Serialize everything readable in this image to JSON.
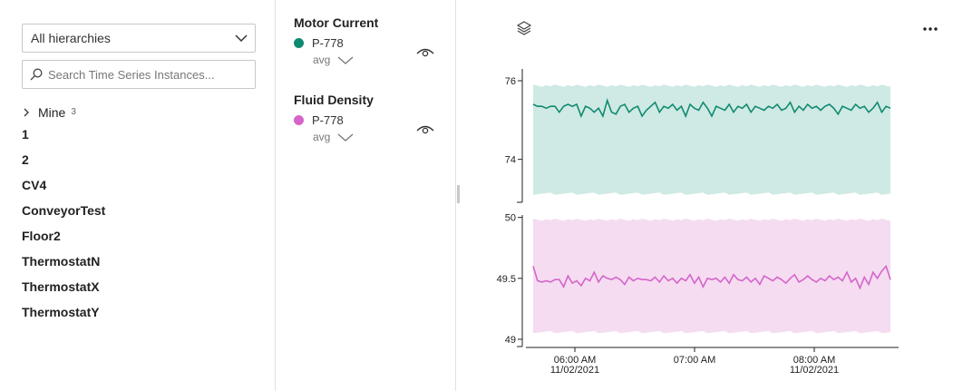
{
  "hierarchy": {
    "dropdown_value": "All hierarchies",
    "search_placeholder": "Search Time Series Instances...",
    "tree": {
      "parent_label": "Mine",
      "parent_count": "3",
      "items": [
        "1",
        "2",
        "CV4",
        "ConveyorTest",
        "Floor2",
        "ThermostatN",
        "ThermostatX",
        "ThermostatY"
      ]
    }
  },
  "legend": {
    "groups": [
      {
        "title": "Motor Current",
        "instance": "P-778",
        "aggregate": "avg",
        "color": "#0f8a72"
      },
      {
        "title": "Fluid Density",
        "instance": "P-778",
        "aggregate": "avg",
        "color": "#d565c9"
      }
    ]
  },
  "chart_data": {
    "type": "line",
    "x_ticks": [
      {
        "time": "06:00 AM",
        "date": "11/02/2021"
      },
      {
        "time": "07:00 AM",
        "date": ""
      },
      {
        "time": "08:00 AM",
        "date": "11/02/2021"
      }
    ],
    "x_range": [
      "05:35 AM",
      "08:40 AM"
    ],
    "series": [
      {
        "name": "Motor Current",
        "color": "#0f8a72",
        "band_color": "#cfe9e4",
        "ylim": [
          73.0,
          76.3
        ],
        "y_ticks": [
          "76",
          "74"
        ],
        "y_tick_values": [
          76,
          74
        ],
        "band": [
          73.1,
          75.9
        ],
        "values": [
          75.4,
          75.35,
          75.35,
          75.3,
          75.35,
          75.35,
          75.2,
          75.35,
          75.4,
          75.35,
          75.4,
          75.1,
          75.35,
          75.3,
          75.2,
          75.3,
          75.1,
          75.5,
          75.2,
          75.15,
          75.35,
          75.4,
          75.2,
          75.3,
          75.35,
          75.1,
          75.25,
          75.35,
          75.45,
          75.2,
          75.35,
          75.3,
          75.4,
          75.25,
          75.35,
          75.1,
          75.4,
          75.3,
          75.25,
          75.45,
          75.3,
          75.1,
          75.35,
          75.3,
          75.25,
          75.4,
          75.2,
          75.35,
          75.3,
          75.4,
          75.2,
          75.35,
          75.3,
          75.25,
          75.35,
          75.3,
          75.4,
          75.25,
          75.3,
          75.45,
          75.2,
          75.35,
          75.25,
          75.4,
          75.3,
          75.35,
          75.25,
          75.35,
          75.4,
          75.3,
          75.15,
          75.35,
          75.3,
          75.25,
          75.4,
          75.3,
          75.35,
          75.2,
          75.3,
          75.45,
          75.2,
          75.35,
          75.3
        ]
      },
      {
        "name": "Fluid Density",
        "color": "#d565c9",
        "band_color": "#f5dcf1",
        "ylim": [
          48.97,
          50.02
        ],
        "y_ticks": [
          "50",
          "49.5",
          "49"
        ],
        "y_tick_values": [
          50,
          49.5,
          49
        ],
        "band": [
          49.05,
          49.99
        ],
        "values": [
          49.6,
          49.48,
          49.47,
          49.48,
          49.47,
          49.49,
          49.49,
          49.43,
          49.52,
          49.46,
          49.48,
          49.44,
          49.5,
          49.48,
          49.55,
          49.47,
          49.52,
          49.5,
          49.49,
          49.51,
          49.49,
          49.45,
          49.51,
          49.48,
          49.5,
          49.49,
          49.49,
          49.48,
          49.51,
          49.47,
          49.52,
          49.48,
          49.5,
          49.46,
          49.5,
          49.48,
          49.53,
          49.46,
          49.51,
          49.43,
          49.5,
          49.49,
          49.5,
          49.47,
          49.51,
          49.46,
          49.53,
          49.49,
          49.48,
          49.51,
          49.47,
          49.5,
          49.45,
          49.52,
          49.5,
          49.48,
          49.51,
          49.49,
          49.46,
          49.5,
          49.53,
          49.47,
          49.49,
          49.52,
          49.49,
          49.47,
          49.5,
          49.48,
          49.52,
          49.49,
          49.51,
          49.48,
          49.55,
          49.47,
          49.5,
          49.42,
          49.51,
          49.45,
          49.55,
          49.5,
          49.56,
          49.6,
          49.49
        ]
      }
    ]
  }
}
